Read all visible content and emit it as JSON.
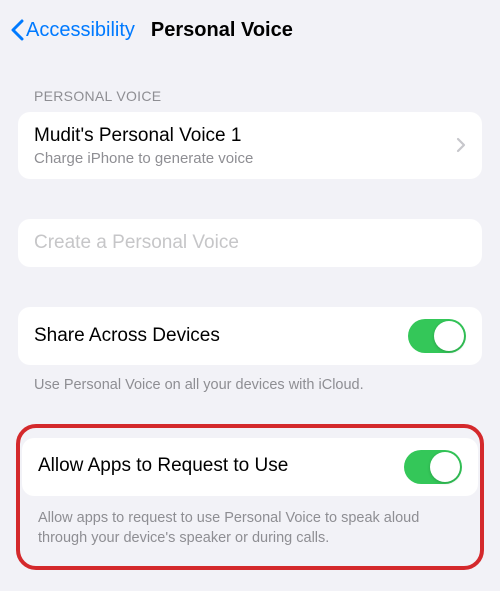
{
  "nav": {
    "back_label": "Accessibility",
    "title": "Personal Voice"
  },
  "section1": {
    "header": "PERSONAL VOICE",
    "voice_row": {
      "title": "Mudit's Personal Voice 1",
      "subtitle": "Charge iPhone to generate voice"
    }
  },
  "create_row": {
    "title": "Create a Personal Voice"
  },
  "share_row": {
    "title": "Share Across Devices",
    "footer": "Use Personal Voice on all your devices with iCloud."
  },
  "allow_row": {
    "title": "Allow Apps to Request to Use",
    "footer": "Allow apps to request to use Personal Voice to speak aloud through your device's speaker or during calls."
  }
}
